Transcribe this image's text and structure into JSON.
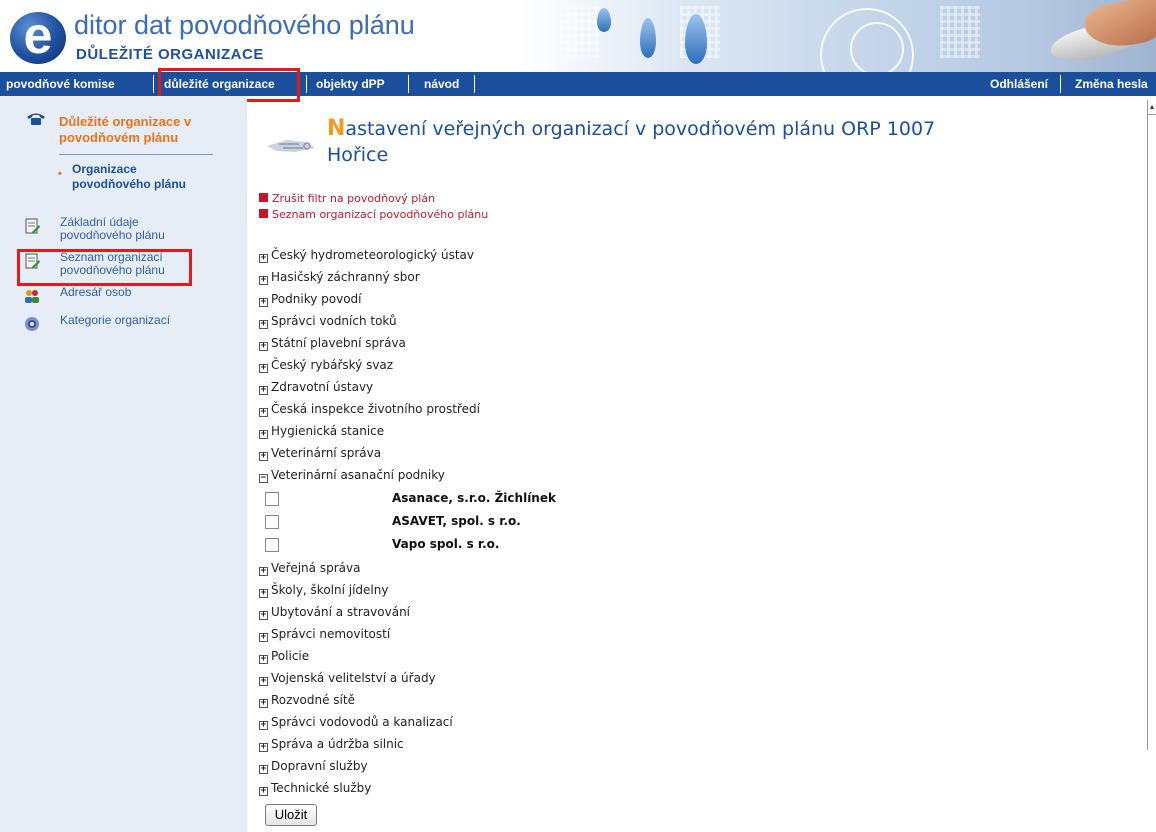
{
  "header": {
    "logo_letter": "e",
    "title": "ditor dat povodňového plánu",
    "subtitle": "DŮLEŽITÉ ORGANIZACE"
  },
  "nav": {
    "items": [
      "povodňové komise",
      "důležité organizace",
      "objekty dPP",
      "návod"
    ],
    "right_items": [
      "Odhlášení",
      "Změna hesla"
    ]
  },
  "sidebar": {
    "heading": "Důležité organizace v povodňovém plánu",
    "subheading": "Organizace povodňového plánu",
    "items": [
      {
        "label": "Základní údaje povodňového plánu",
        "icon": "document-edit-icon"
      },
      {
        "label": "Seznam organizací povodňového plánu",
        "icon": "document-edit-icon"
      },
      {
        "label": "Adresář osob",
        "icon": "people-icon"
      },
      {
        "label": "Kategorie organizací",
        "icon": "gear-icon"
      }
    ]
  },
  "main": {
    "title_first": "N",
    "title_rest": "astavení veřejných organizací v povodňovém plánu ORP 1007 Hořice",
    "links": [
      "Zrušit filtr na povodňový plán",
      "Seznam organizací povodňového plánu"
    ],
    "categories_before": [
      "Český hydrometeorologický ústav",
      "Hasičský záchranný sbor",
      "Podniky povodí",
      "Správci vodních toků",
      "Státní plavební správa",
      "Český rybářský svaz",
      "Zdravotní ústavy",
      "Česká inspekce životního prostředí",
      "Hygienická stanice",
      "Veterinární správa"
    ],
    "expanded_category": "Veterinární asanační podniky",
    "organizations": [
      "Asanace, s.r.o. Žichlínek",
      "ASAVET, spol. s r.o.",
      "Vapo spol. s r.o."
    ],
    "categories_after": [
      "Veřejná správa",
      "Školy, školní jídelny",
      "Ubytování a stravování",
      "Správci nemovitostí",
      "Policie",
      "Vojenská velitelství a úřady",
      "Rozvodné sítě",
      "Správci vodovodů a kanalizací",
      "Správa a údržba silnic",
      "Dopravní služby",
      "Technické služby"
    ],
    "save_label": "Uložit"
  },
  "colors": {
    "nav_bg": "#1b4f9b",
    "sidebar_bg": "#e6edf6",
    "accent_orange": "#e8731b",
    "link_red": "#c01a2a",
    "highlight_box": "#e01b1b"
  }
}
